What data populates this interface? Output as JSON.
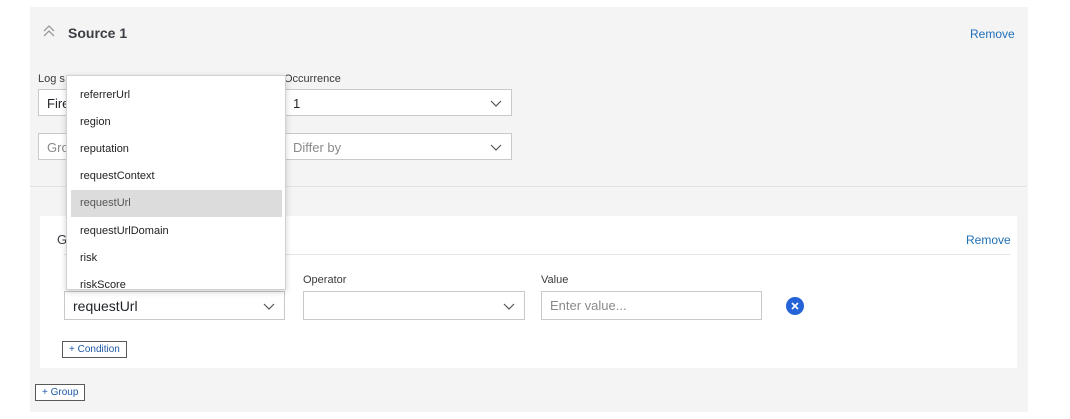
{
  "source": {
    "title": "Source 1",
    "remove_label": "Remove",
    "log_source_label_partial": "Log s",
    "log_source_value_partial": "Fire",
    "group_by_placeholder_partial": "Gro",
    "occurrence_label_partial": "Occurrence",
    "occurrence_value": "1",
    "differ_by_placeholder": "Differ by"
  },
  "group": {
    "title_partial": "G",
    "remove_label": "Remove",
    "field_value": "requestUrl",
    "operator_label": "Operator",
    "operator_value": "",
    "value_label": "Value",
    "value_placeholder": "Enter value...",
    "add_condition_label": "+ Condition"
  },
  "add_group_label": "+ Group",
  "dropdown": {
    "items": [
      "referrerUrl",
      "region",
      "reputation",
      "requestContext",
      "requestUrl",
      "requestUrlDomain",
      "risk",
      "riskScore"
    ],
    "selected": "requestUrl"
  },
  "colors": {
    "accent": "#2563d8",
    "link": "#1e6fb8",
    "panel": "#f4f4f4"
  },
  "icons": {
    "collapse": "chevron-double-up-icon",
    "caret": "chevron-down-icon",
    "clear": "close-circle-icon"
  }
}
